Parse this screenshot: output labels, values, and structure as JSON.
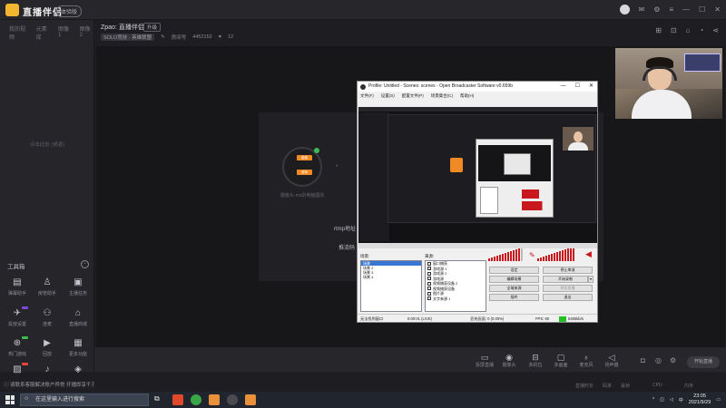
{
  "topbar": {
    "app_name": "直播伴侣",
    "beta": "体验版",
    "icons": [
      "avatar-icon",
      "message-icon",
      "settings-icon",
      "menu-icon",
      "minimize-icon",
      "maximize-icon",
      "close-icon"
    ]
  },
  "sidebar": {
    "tabs": [
      "我的视频",
      "元素库",
      "图像 1",
      "图像 2"
    ],
    "empty_text": "点击此处 (或者)",
    "tools_title": "工具箱",
    "tools": [
      {
        "label": "弹幕助手",
        "icon": "comment-icon"
      },
      {
        "label": "房管助手",
        "icon": "person-icon"
      },
      {
        "label": "主播任务",
        "icon": "task-icon"
      },
      {
        "label": "投放设置",
        "icon": "send-icon",
        "badge": "#7a4cd9"
      },
      {
        "label": "连麦",
        "icon": "users-icon"
      },
      {
        "label": "直播商城",
        "icon": "shop-icon"
      },
      {
        "label": "热门游戏",
        "icon": "gamepad-icon",
        "badge": "#3cba54"
      },
      {
        "label": "回放",
        "icon": "play-icon"
      },
      {
        "label": "更多功能",
        "icon": "grid-icon"
      },
      {
        "label": "图片",
        "icon": "image-icon",
        "badge": "#e8423a"
      },
      {
        "label": "",
        "icon": "music-icon"
      },
      {
        "label": "",
        "icon": "box-icon"
      }
    ]
  },
  "header": {
    "title": "Zpao: 直播伴侣",
    "tag": "升级",
    "category": "SOLO竞技 · 英雄联盟",
    "room_label": "房间号",
    "room_id": "4452152",
    "fans_count": "12"
  },
  "preview": {
    "source_buttons": [
      "摄像",
      "游戏"
    ],
    "source_text": "摄像头·ms的电脑图的",
    "rtmp_label": "rtmp地址",
    "push_label": "推流码"
  },
  "obs": {
    "title": "Profile: Untitled - Scenes: scenes - Open Broadcaster Software v0.659b",
    "win_buttons": [
      "—",
      "☐",
      "✕"
    ],
    "menu": [
      "文件(F)",
      "设置(S)",
      "配置文件(P)",
      "场景集合(C)",
      "帮助(H)"
    ],
    "scenes_label": "场景:",
    "sources_label": "来源:",
    "scenes": [
      "场景",
      "场景 2",
      "场景 3",
      "场景 4"
    ],
    "sources": [
      "窗口捕获",
      "游戏源 1",
      "游戏源 2",
      "游戏源",
      "视频捕获设备 2",
      "视频捕获设备",
      "图片源",
      "文字来源 1"
    ],
    "buttons": [
      "设定",
      "停止串流",
      "编辑场景",
      "开始录制",
      "全域来源",
      "预览直播",
      "插件",
      "退出"
    ],
    "status": [
      "无法找到窗口",
      "0:00:01 (LIVE)",
      "丢失画面: 0 (0.00%)",
      "FPS: 60",
      "5465kb/s"
    ]
  },
  "bottombar": {
    "tools": [
      {
        "label": "投屏直播",
        "icon": "cast-icon"
      },
      {
        "label": "摄像头",
        "icon": "camera-icon"
      },
      {
        "label": "多机位",
        "icon": "multi-cam-icon"
      },
      {
        "label": "多画面",
        "icon": "screen-icon"
      },
      {
        "label": "麦克风",
        "icon": "mic-icon"
      },
      {
        "label": "扬声器",
        "icon": "speaker-icon"
      }
    ],
    "start_button": "开始直播"
  },
  "statusline": {
    "announce": "请联系客服解决账户异常 开播即享千万流量 有新用户奖励",
    "items": [
      "直播时长",
      "码率",
      "丢帧",
      "CPU",
      "内存"
    ]
  },
  "taskbar": {
    "search_placeholder": "在这里输入进行搜索",
    "time": "23:05",
    "date": "2021/9/29"
  }
}
